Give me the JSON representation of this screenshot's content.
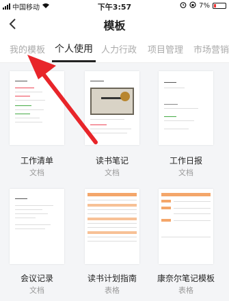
{
  "status_bar": {
    "carrier": "中国移动",
    "time": "下午3:57",
    "battery": "7%"
  },
  "nav": {
    "title": "模板"
  },
  "tabs": [
    {
      "label": "我的模板"
    },
    {
      "label": "个人使用"
    },
    {
      "label": "人力行政"
    },
    {
      "label": "项目管理"
    },
    {
      "label": "市场营销"
    }
  ],
  "templates": [
    {
      "name": "工作清单",
      "type": "文档"
    },
    {
      "name": "读书笔记",
      "type": "文档"
    },
    {
      "name": "工作日报",
      "type": "文档"
    },
    {
      "name": "会议记录",
      "type": "文档"
    },
    {
      "name": "读书计划指南",
      "type": "表格"
    },
    {
      "name": "康奈尔笔记模板",
      "type": "表格"
    }
  ],
  "colors": {
    "accent_arrow": "#e8252a",
    "active_tab": "#222222",
    "inactive_tab": "#aaaaaa"
  }
}
